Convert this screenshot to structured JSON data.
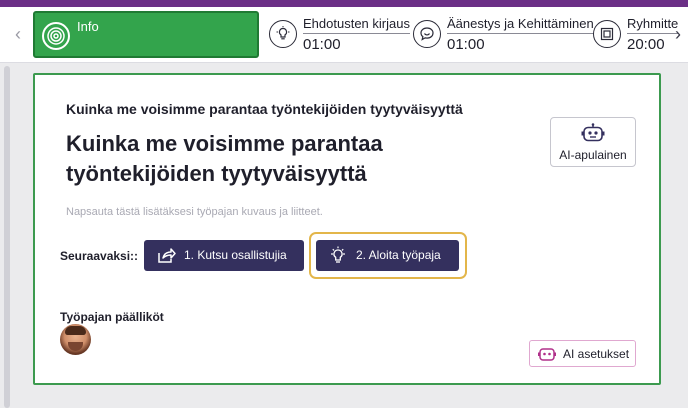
{
  "steps": [
    {
      "name": "Info",
      "icon": "target-icon",
      "active": true
    },
    {
      "name": "Ehdotusten kirjaus",
      "time": "01:00",
      "icon": "lightbulb-icon"
    },
    {
      "name": "Äänestys ja Kehittäminen",
      "time": "01:00",
      "icon": "chat-bubble-icon"
    },
    {
      "name": "Ryhmitte",
      "time": "20:00",
      "icon": "frame-icon"
    }
  ],
  "nav": {
    "prev": "‹",
    "next": "›"
  },
  "card": {
    "subtitle": "Kuinka me voisimme parantaa työntekijöiden tyytyväisyyttä",
    "title": "Kuinka me voisimme parantaa työntekijöiden tyytyväisyyttä",
    "description_placeholder": "Napsauta tästä lisätäksesi työpajan kuvaus ja liitteet.",
    "ai_assistant_label": "AI-apulainen",
    "next_label": "Seuraavaksi::",
    "invite_button": "1. Kutsu osallistujia",
    "start_button": "2. Aloita työpaja",
    "leaders_label": "Työpajan päälliköt",
    "ai_settings_label": "AI asetukset"
  },
  "colors": {
    "active_step": "#33a44c",
    "primary_button": "#34305e",
    "focus_ring": "#e3b64a",
    "top_bar": "#6b2f86"
  }
}
